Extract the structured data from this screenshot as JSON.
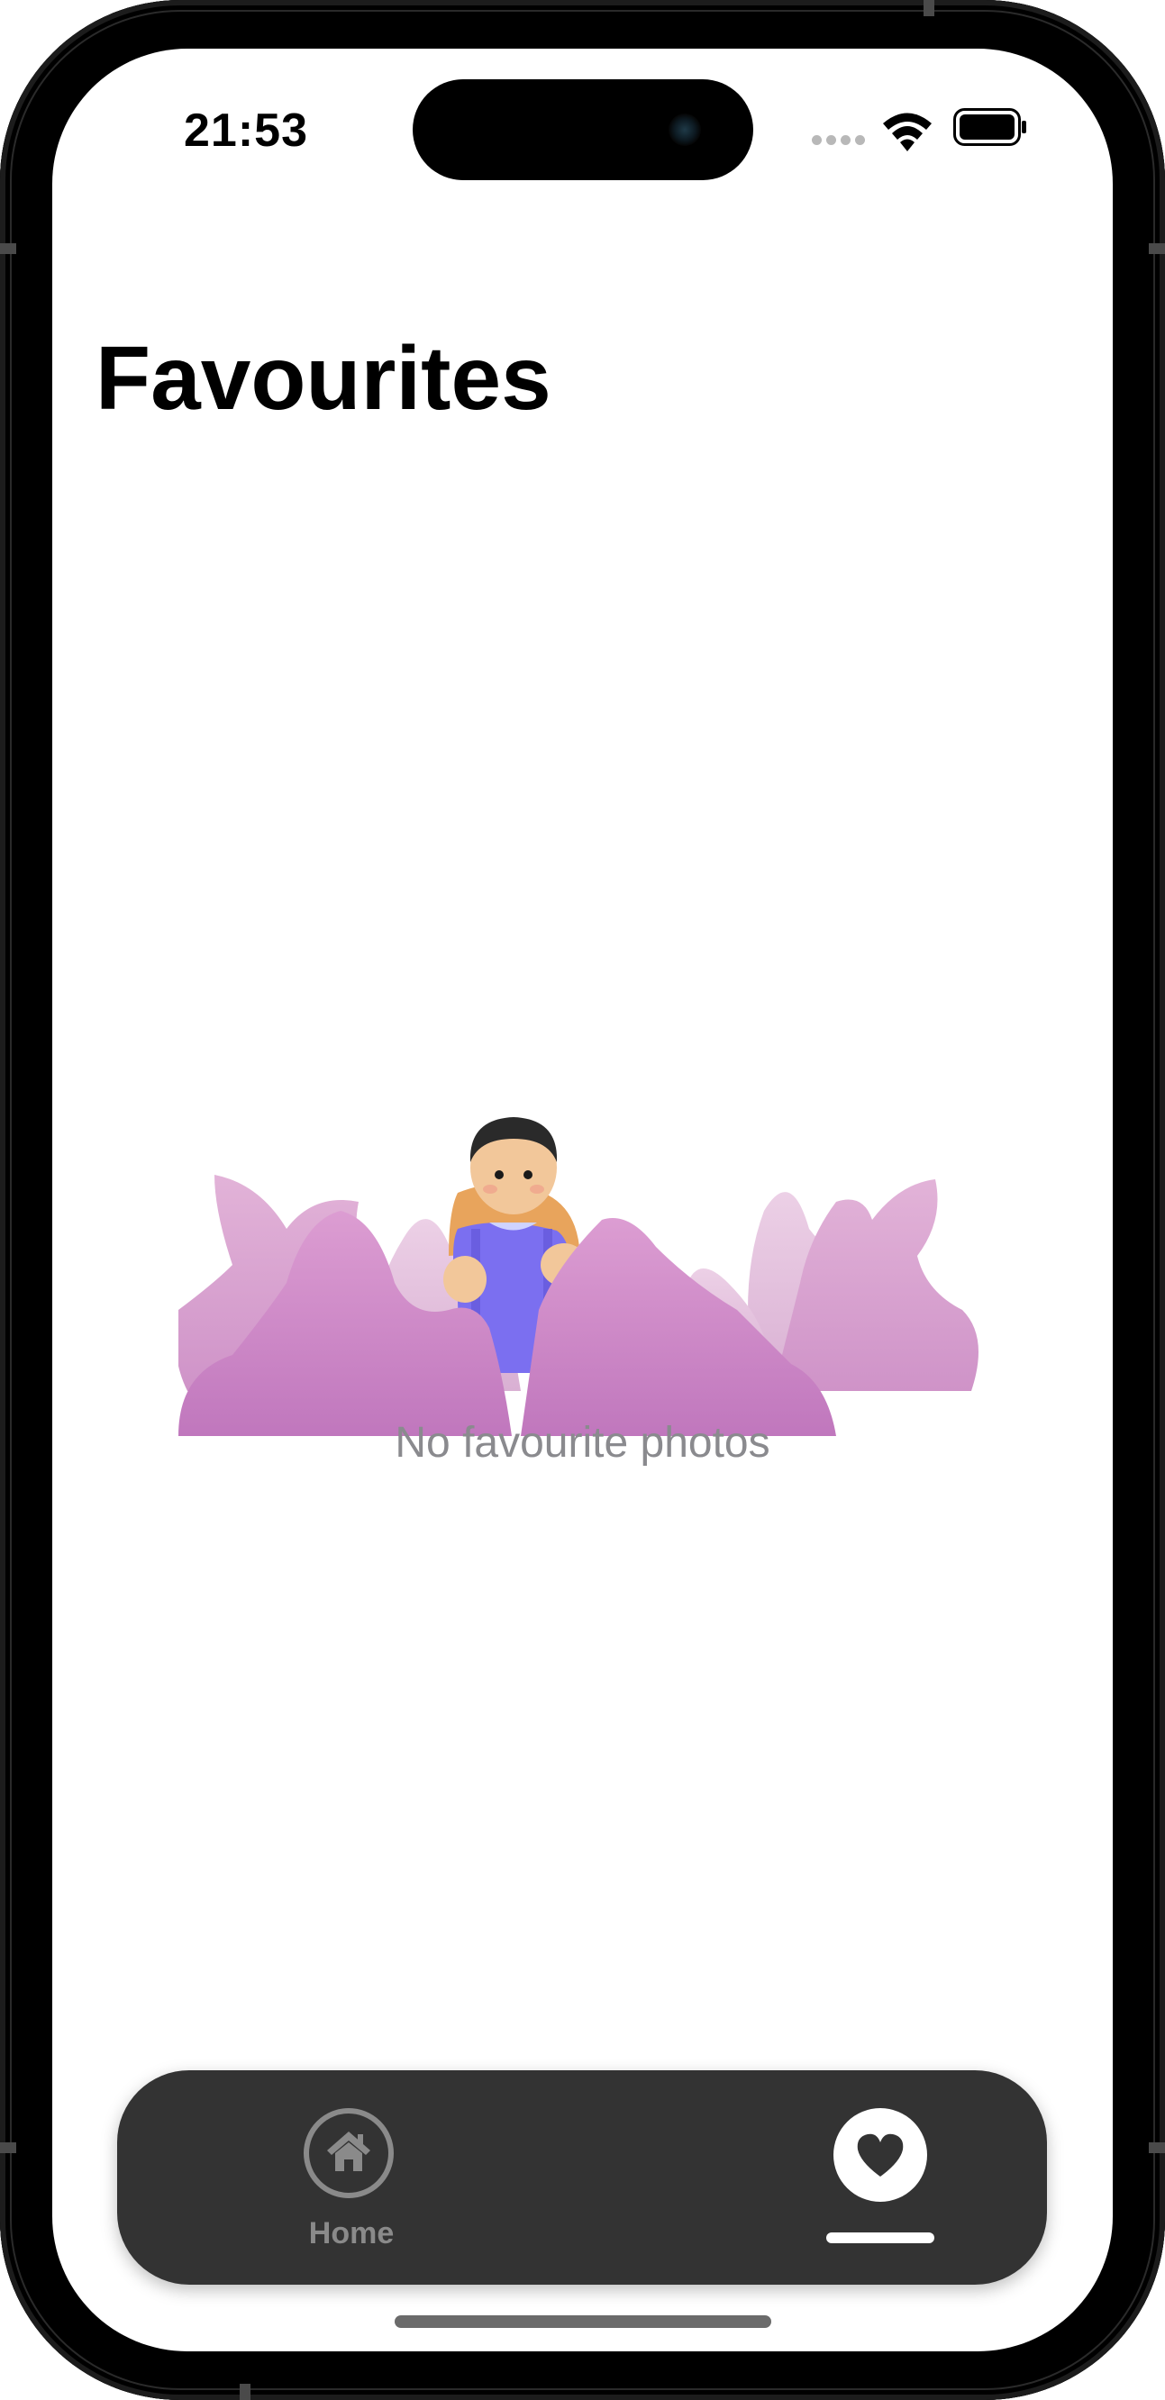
{
  "status_bar": {
    "time": "21:53"
  },
  "page": {
    "title": "Favourites"
  },
  "empty_state": {
    "message": "No favourite photos",
    "illustration": "person-among-pink-bushes"
  },
  "tab_bar": {
    "tabs": [
      {
        "label": "Home",
        "icon": "home-icon",
        "active": false
      },
      {
        "label": "",
        "icon": "heart-icon",
        "active": true
      }
    ]
  },
  "colors": {
    "tab_bar_background": "#333333",
    "inactive_tab": "#8a8a8a",
    "active_tab": "#ffffff",
    "secondary_text": "#8a8a8e",
    "bush_pink": "#d28cc6",
    "character_shirt": "#7b6ff0"
  }
}
